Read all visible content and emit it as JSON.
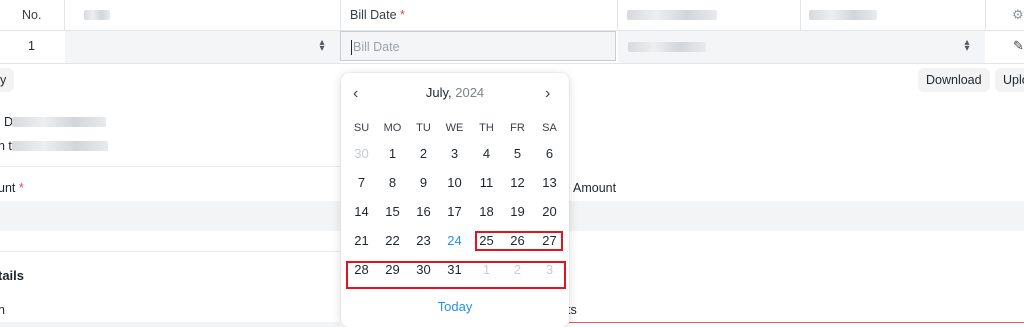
{
  "table": {
    "header": {
      "no_label": "No.",
      "bill_date_label": "Bill Date",
      "required_mark": "*"
    },
    "row": {
      "number": "1",
      "bill_date_placeholder": "Bill Date"
    }
  },
  "buttons": {
    "download": "Download",
    "upload": "Uplo"
  },
  "partial_text": {
    "left_button_fragment": "y",
    "line1_fragment": "D",
    "line2_fragment": "n t",
    "amount_fragment": "unt",
    "amount_required_mark": "*",
    "amount_right": "Amount",
    "details_fragment": "tails",
    "bottom_left_fragment": "n",
    "bottom_mid_fragment": "ts"
  },
  "calendar": {
    "month": "July,",
    "year": "2024",
    "prev_icon": "chevron-left-icon",
    "next_icon": "chevron-right-icon",
    "weekdays": [
      "SU",
      "MO",
      "TU",
      "WE",
      "TH",
      "FR",
      "SA"
    ],
    "weeks": [
      [
        "30",
        "1",
        "2",
        "3",
        "4",
        "5",
        "6"
      ],
      [
        "7",
        "8",
        "9",
        "10",
        "11",
        "12",
        "13"
      ],
      [
        "14",
        "15",
        "16",
        "17",
        "18",
        "19",
        "20"
      ],
      [
        "21",
        "22",
        "23",
        "24",
        "25",
        "26",
        "27"
      ],
      [
        "28",
        "29",
        "30",
        "31",
        "1",
        "2",
        "3"
      ]
    ],
    "today_label": "Today",
    "today_color": "#2490ef",
    "highlight_color": "#e2141f"
  },
  "icons": {
    "settings": "gear-icon",
    "edit": "pencil-icon",
    "stepper": "chevron-up-down-icon"
  }
}
